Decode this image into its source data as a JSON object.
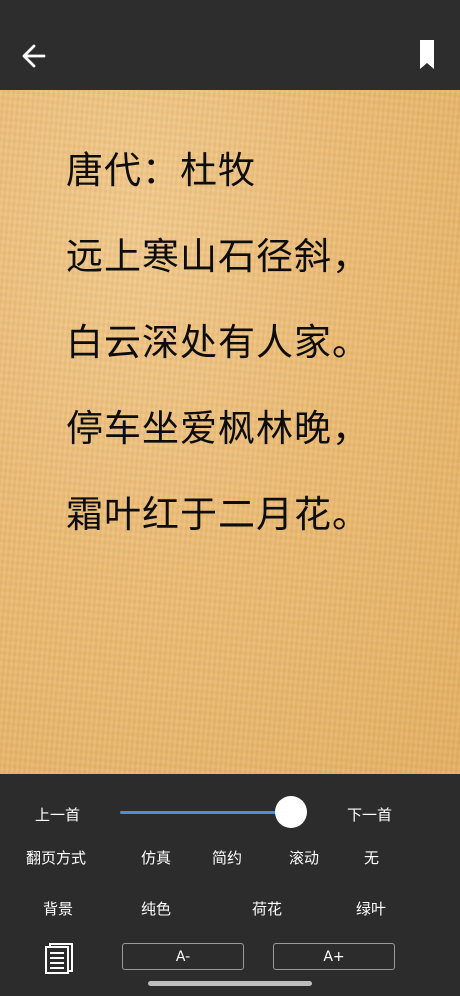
{
  "topbar": {
    "back_icon": "arrow-left-icon",
    "bookmark_icon": "bookmark-icon"
  },
  "poem": {
    "lines": [
      "唐代：杜牧",
      "远上寒山石径斜，",
      "白云深处有人家。",
      "停车坐爱枫林晚，",
      "霜叶红于二月花。"
    ]
  },
  "controls": {
    "prev_label": "上一首",
    "next_label": "下一首",
    "progress": 0.92,
    "page_turn": {
      "label": "翻页方式",
      "options": [
        "仿真",
        "简约",
        "滚动",
        "无"
      ]
    },
    "background": {
      "label": "背景",
      "options": [
        "纯色",
        "荷花",
        "绿叶"
      ]
    },
    "font_decrease": "A-",
    "font_increase": "A+",
    "toc_icon": "document-list-icon"
  },
  "colors": {
    "bar_bg": "#2c2c2c",
    "slider": "#4a90d9",
    "paper": "#ebbb74"
  }
}
